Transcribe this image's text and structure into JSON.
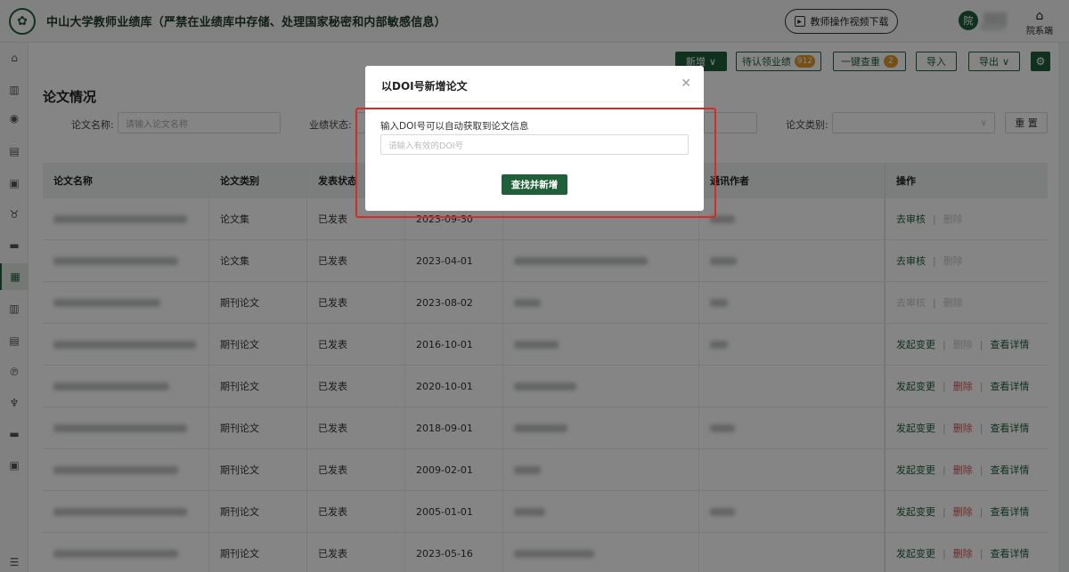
{
  "header": {
    "title": "中山大学教师业绩库（严禁在业绩库中存储、处理国家秘密和内部敏感信息）",
    "video_button": "教师操作视频下载",
    "user_badge": "院",
    "dept_label": "院系端"
  },
  "toolbar": {
    "new_label": "新增",
    "pending_label": "待认领业绩",
    "pending_count": "912",
    "dedupe_label": "一键查重",
    "dedupe_count": "2",
    "import_label": "导入",
    "export_label": "导出"
  },
  "section_title": "论文情况",
  "filters": {
    "name_label": "论文名称:",
    "name_placeholder": "请输入论文名称",
    "status_label": "业绩状态:",
    "type_label": "论文类别:",
    "reset_label": "重 置"
  },
  "table": {
    "headers": [
      "论文名称",
      "论文类别",
      "发表状态",
      "",
      "",
      "通讯作者",
      "操作"
    ],
    "rows": [
      {
        "type": "论文集",
        "status": "已发表",
        "date": "2023-09-30",
        "actions": [
          "去审核",
          "删除"
        ],
        "states": [
          "on",
          "off"
        ]
      },
      {
        "type": "论文集",
        "status": "已发表",
        "date": "2023-04-01",
        "actions": [
          "去审核",
          "删除"
        ],
        "states": [
          "on",
          "off"
        ]
      },
      {
        "type": "期刊论文",
        "status": "已发表",
        "date": "2023-08-02",
        "actions": [
          "去审核",
          "删除"
        ],
        "states": [
          "off",
          "off"
        ]
      },
      {
        "type": "期刊论文",
        "status": "已发表",
        "date": "2016-10-01",
        "actions": [
          "发起变更",
          "删除",
          "查看详情"
        ],
        "states": [
          "on",
          "off",
          "on"
        ]
      },
      {
        "type": "期刊论文",
        "status": "已发表",
        "date": "2020-10-01",
        "actions": [
          "发起变更",
          "删除",
          "查看详情"
        ],
        "states": [
          "on",
          "del",
          "on"
        ]
      },
      {
        "type": "期刊论文",
        "status": "已发表",
        "date": "2018-09-01",
        "actions": [
          "发起变更",
          "删除",
          "查看详情"
        ],
        "states": [
          "on",
          "del",
          "on"
        ]
      },
      {
        "type": "期刊论文",
        "status": "已发表",
        "date": "2009-02-01",
        "actions": [
          "发起变更",
          "删除",
          "查看详情"
        ],
        "states": [
          "on",
          "del",
          "on"
        ]
      },
      {
        "type": "期刊论文",
        "status": "已发表",
        "date": "2005-01-01",
        "actions": [
          "发起变更",
          "删除",
          "查看详情"
        ],
        "states": [
          "on",
          "del",
          "on"
        ]
      },
      {
        "type": "期刊论文",
        "status": "已发表",
        "date": "2023-05-16",
        "actions": [
          "发起变更",
          "删除",
          "查看详情"
        ],
        "states": [
          "on",
          "del",
          "on"
        ]
      }
    ]
  },
  "modal": {
    "title": "以DOI号新增论文",
    "field_label": "输入DOI号可以自动获取到论文信息",
    "placeholder": "请输入有效的DOI号",
    "submit_label": "查找并新增"
  }
}
